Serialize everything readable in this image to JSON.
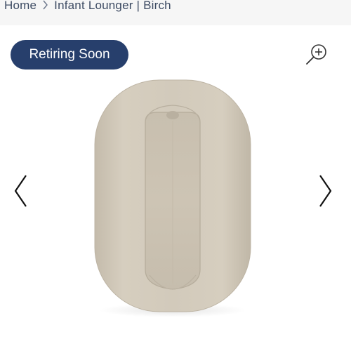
{
  "breadcrumb": {
    "home": "Home",
    "current": "Infant Lounger | Birch"
  },
  "gallery": {
    "badge": "Retiring Soon"
  },
  "icons": {
    "breadcrumb_separator": "chevron-right-icon",
    "zoom": "zoom-in-icon",
    "prev": "chevron-left-icon",
    "next": "chevron-right-icon"
  },
  "colors": {
    "badge_background": "#273f6c",
    "breadcrumb_text": "#3d4b63",
    "product_fabric": "#cfc6b6"
  }
}
